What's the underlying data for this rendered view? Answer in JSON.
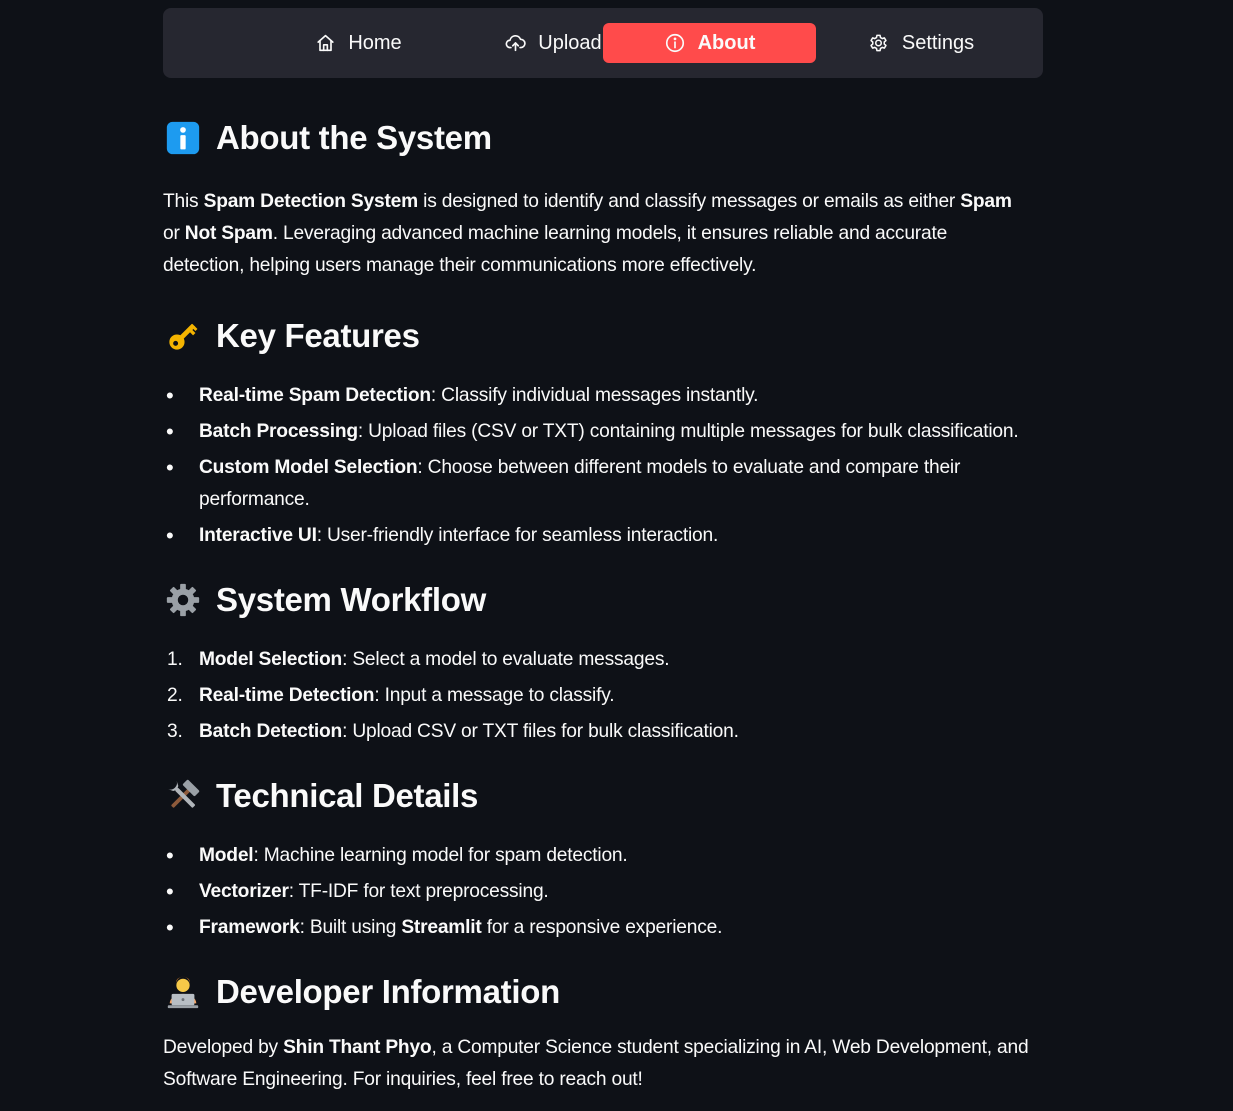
{
  "nav": {
    "items": [
      {
        "label": "Home",
        "icon": "home-icon",
        "active": false
      },
      {
        "label": "Upload",
        "icon": "cloud-upload-icon",
        "active": false
      },
      {
        "label": "About",
        "icon": "info-circle-icon",
        "active": true
      },
      {
        "label": "Settings",
        "icon": "gear-icon",
        "active": false
      }
    ],
    "active_color": "#ff4b4b"
  },
  "about": {
    "heading": "About the System",
    "icon": "info-emoji",
    "p_pre": "This ",
    "p_b1": "Spam Detection System",
    "p_mid1": " is designed to identify and classify messages or emails as either ",
    "p_b2": "Spam",
    "p_mid2": " or ",
    "p_b3": "Not Spam",
    "p_post": ". Leveraging advanced machine learning models, it ensures reliable and accurate detection, helping users manage their communications more effectively."
  },
  "features": {
    "heading": "Key Features",
    "icon": "key-emoji",
    "items": [
      {
        "bold": "Real-time Spam Detection",
        "text": ": Classify individual messages instantly."
      },
      {
        "bold": "Batch Processing",
        "text": ": Upload files (CSV or TXT) containing multiple messages for bulk classification."
      },
      {
        "bold": "Custom Model Selection",
        "text": ": Choose between different models to evaluate and compare their performance."
      },
      {
        "bold": "Interactive UI",
        "text": ": User-friendly interface for seamless interaction."
      }
    ]
  },
  "workflow": {
    "heading": "System Workflow",
    "icon": "gear-emoji",
    "items": [
      {
        "num": "1.",
        "bold": "Model Selection",
        "text": ": Select a model to evaluate messages."
      },
      {
        "num": "2.",
        "bold": "Real-time Detection",
        "text": ": Input a message to classify."
      },
      {
        "num": "3.",
        "bold": "Batch Detection",
        "text": ": Upload CSV or TXT files for bulk classification."
      }
    ]
  },
  "technical": {
    "heading": "Technical Details",
    "icon": "hammer-wrench-emoji",
    "items": [
      {
        "bold": "Model",
        "text": ": Machine learning model for spam detection."
      },
      {
        "bold": "Vectorizer",
        "text": ": TF-IDF for text preprocessing."
      }
    ],
    "framework": {
      "bold": "Framework",
      "pre": ": Built using ",
      "bold2": "Streamlit",
      "post": " for a responsive experience."
    }
  },
  "developer": {
    "heading": "Developer Information",
    "icon": "technologist-emoji",
    "p_pre": "Developed by ",
    "p_name": "Shin Thant Phyo",
    "p_post": ", a Computer Science student specializing in AI, Web Development, and Software Engineering. For inquiries, feel free to reach out!"
  },
  "bullet": "•"
}
